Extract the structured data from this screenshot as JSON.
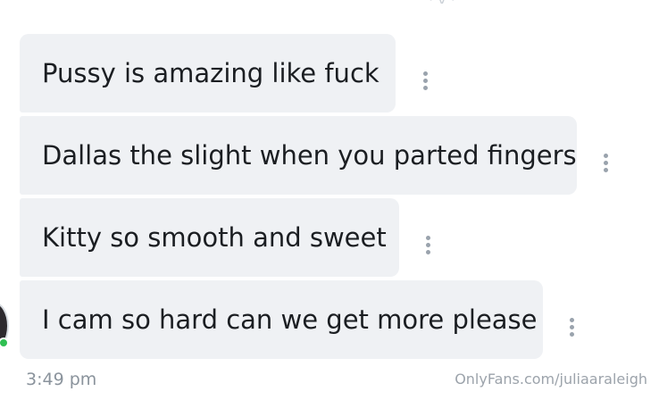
{
  "chat": {
    "messages": [
      {
        "text": "Pussy is amazing like fuck"
      },
      {
        "text": "Dallas the slight when you parted fingers"
      },
      {
        "text": "Kitty so smooth and sweet"
      },
      {
        "text": "I cam so hard can we get more please"
      }
    ],
    "timestamp": "3:49 pm"
  },
  "watermark": "OnlyFans.com/juliaaraleigh",
  "icons": {
    "message_menu": "more-vertical-icon",
    "avatar_status": "online-status"
  },
  "colors": {
    "bubble": "#eff1f4",
    "message_text": "#1b1e22",
    "menu_dots": "#9aa3ad",
    "timestamp": "#8a939c",
    "online": "#2fbf52"
  }
}
